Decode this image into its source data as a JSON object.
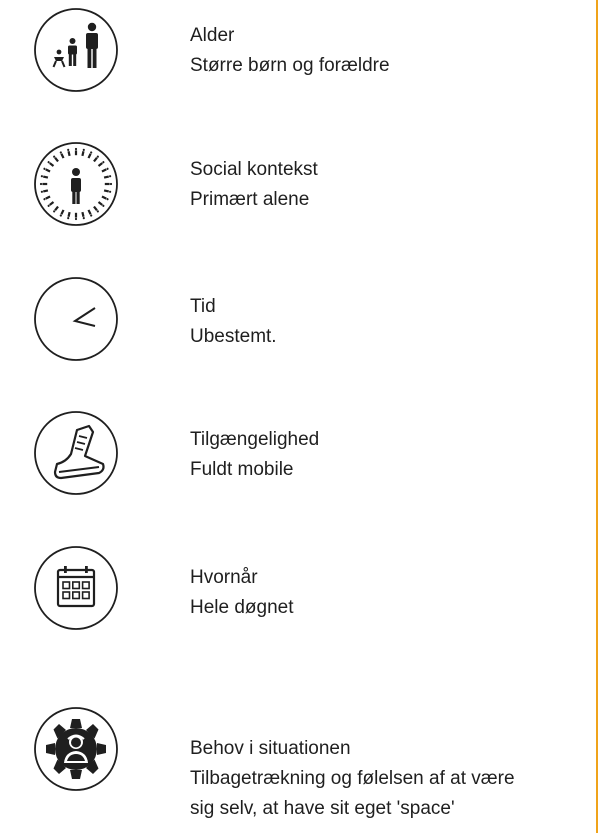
{
  "accent_color": "#f0a31a",
  "items": [
    {
      "icon": "family-age-icon",
      "title": "Alder",
      "lines": [
        "Større børn og forældre"
      ]
    },
    {
      "icon": "social-crowd-icon",
      "title": "Social kontekst",
      "lines": [
        "Primært alene"
      ]
    },
    {
      "icon": "clock-icon",
      "title": "Tid",
      "lines": [
        "Ubestemt."
      ]
    },
    {
      "icon": "shoe-icon",
      "title": "Tilgængelighed",
      "lines": [
        "Fuldt mobile"
      ]
    },
    {
      "icon": "calendar-icon",
      "title": "Hvornår",
      "lines": [
        "Hele døgnet"
      ]
    },
    {
      "icon": "person-gear-icon",
      "title": "Behov i situationen",
      "lines": [
        "Tilbagetrækning og følelsen af at være",
        "sig selv, at have sit eget 'space'"
      ]
    }
  ]
}
